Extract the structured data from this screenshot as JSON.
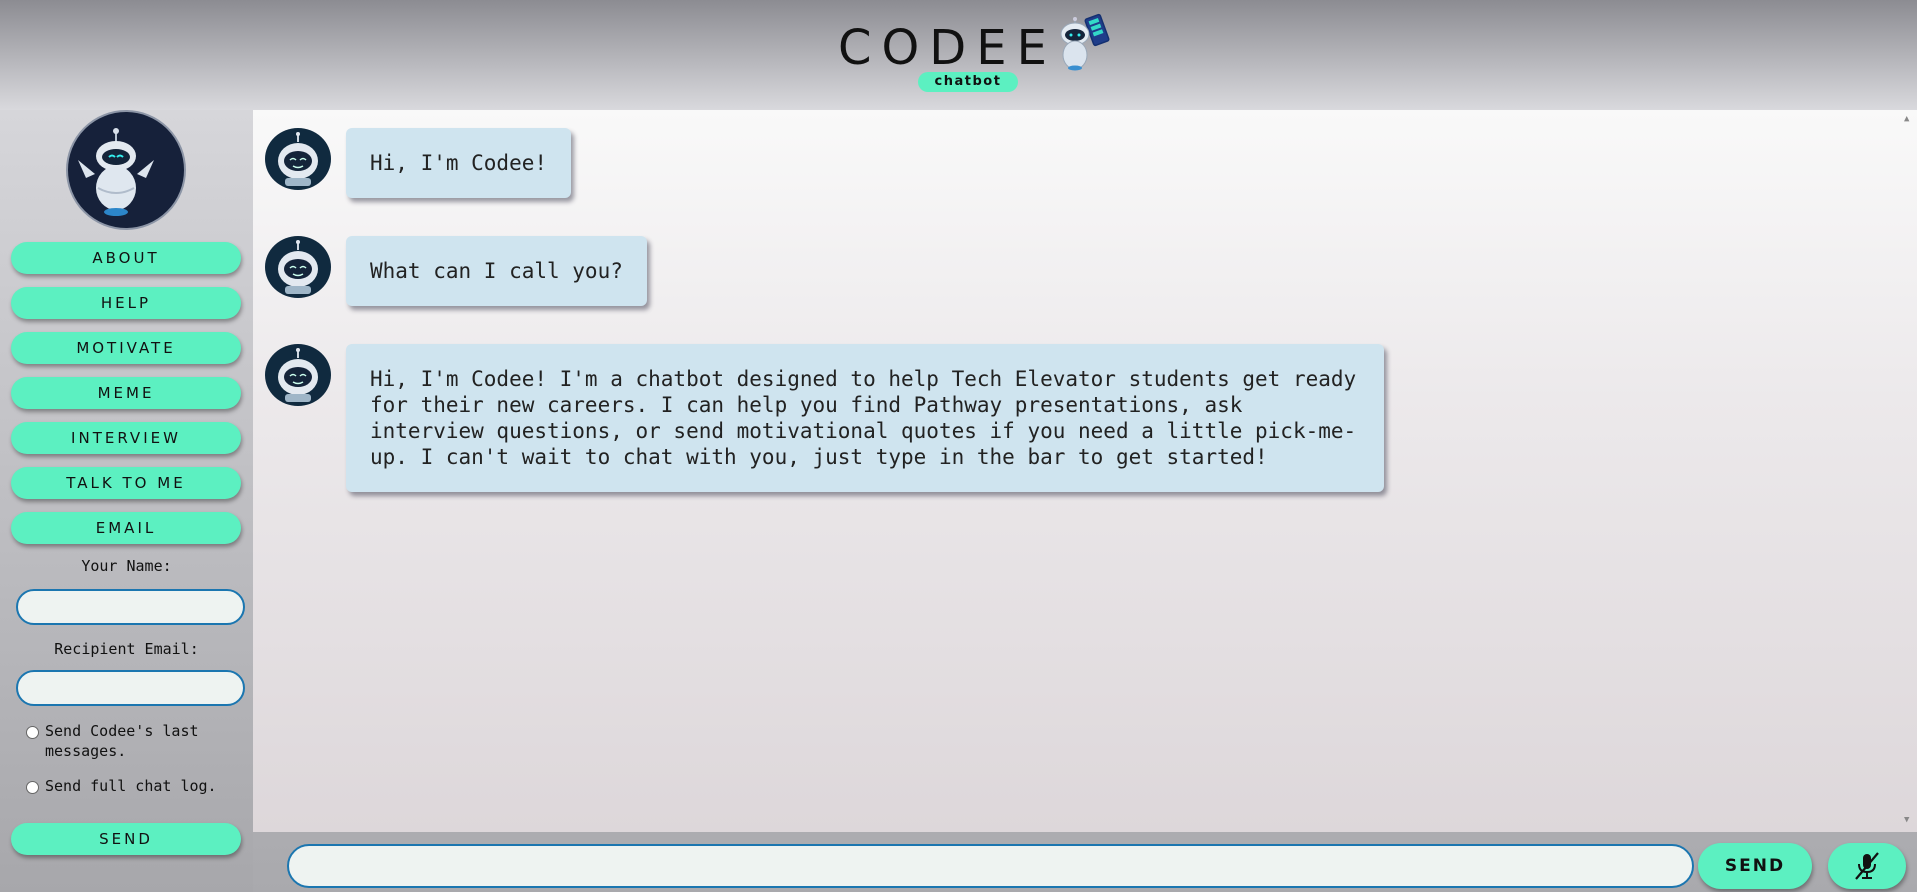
{
  "header": {
    "title": "CODEE",
    "badge": "chatbot",
    "logo_icon": "robot-with-phone-icon"
  },
  "sidebar": {
    "avatar_icon": "robot-avatar-icon",
    "buttons": [
      {
        "label": "ABOUT"
      },
      {
        "label": "HELP"
      },
      {
        "label": "MOTIVATE"
      },
      {
        "label": "MEME"
      },
      {
        "label": "INTERVIEW"
      },
      {
        "label": "TALK TO ME"
      },
      {
        "label": "EMAIL"
      }
    ],
    "name_label": "Your Name:",
    "name_value": "",
    "email_label": "Recipient Email:",
    "email_value": "",
    "radio_options": [
      {
        "label": "Send Codee's last messages.",
        "checked": false
      },
      {
        "label": "Send full chat log.",
        "checked": false
      }
    ],
    "send_label": "SEND"
  },
  "chat": {
    "messages": [
      {
        "sender": "bot",
        "text": "Hi, I'm Codee!"
      },
      {
        "sender": "bot",
        "text": "What can I call you?"
      },
      {
        "sender": "bot",
        "text": "Hi, I'm Codee! I'm a chatbot designed to help Tech Elevator students get ready for their new careers. I can help you find Pathway presentations, ask interview questions, or send motivational quotes if you need a little pick-me-up. I can't wait to chat with you, just type in the bar to get started!"
      }
    ],
    "input_value": "",
    "send_label": "SEND",
    "mic_icon": "microphone-muted-icon"
  },
  "colors": {
    "accent": "#5cf0c1",
    "bubble": "#cfe4ef",
    "input_border": "#1b76b0",
    "avatar_bg": "#102a3f"
  }
}
